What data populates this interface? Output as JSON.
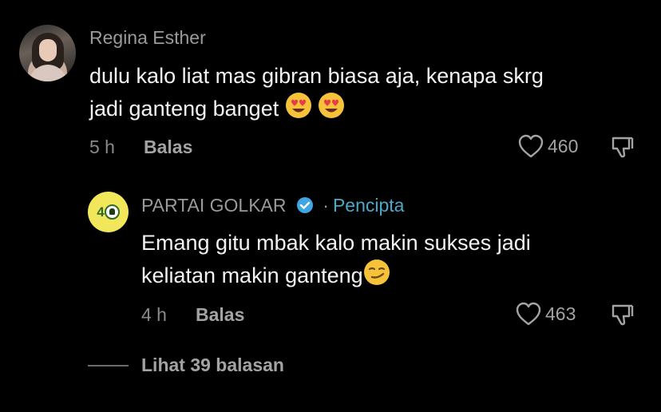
{
  "comment": {
    "username": "Regina Esther",
    "text_line1": "dulu kalo liat mas gibran biasa aja, kenapa skrg",
    "text_line2": "jadi ganteng banget",
    "time": "5 h",
    "reply_label": "Balas",
    "likes": "460"
  },
  "reply": {
    "username": "PARTAI GOLKAR",
    "creator_separator": "·",
    "creator_label": "Pencipta",
    "text_line1": "Emang gitu mbak kalo makin sukses jadi",
    "text_line2": "keliatan makin ganteng",
    "time": "4 h",
    "reply_label": "Balas",
    "likes": "463",
    "avatar_text": "4"
  },
  "view_replies_label": "Lihat 39 balasan",
  "colors": {
    "background": "#000000",
    "creator_tag": "#4aa8c8",
    "verified_badge": "#3ea6e0",
    "golkar_yellow": "#f2e65a"
  }
}
